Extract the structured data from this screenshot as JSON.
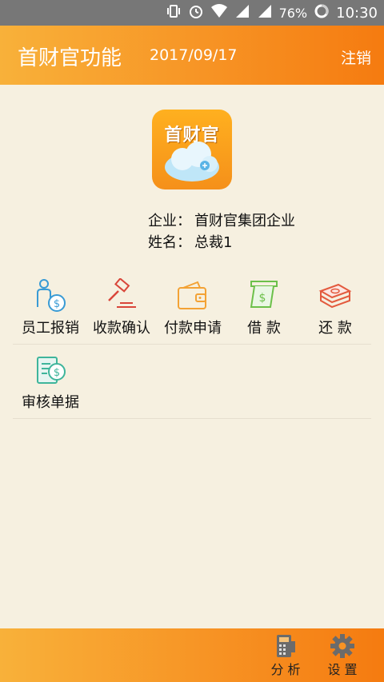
{
  "status_bar": {
    "battery": "76%",
    "time": "10:30"
  },
  "header": {
    "title": "首财官功能",
    "date": "2017/09/17",
    "logout": "注销"
  },
  "logo": {
    "text": "首财官"
  },
  "profile": {
    "company_label": "企业：",
    "company": "首财官集团企业",
    "name_label": "姓名：",
    "name": "总裁1"
  },
  "functions": [
    {
      "label": "员工报销",
      "icon": "employee-reimburse-icon"
    },
    {
      "label": "收款确认",
      "icon": "gavel-icon"
    },
    {
      "label": "付款申请",
      "icon": "wallet-icon"
    },
    {
      "label": "借 款",
      "icon": "cash-dispense-icon"
    },
    {
      "label": "还 款",
      "icon": "money-stack-icon"
    },
    {
      "label": "审核单据",
      "icon": "document-audit-icon"
    }
  ],
  "bottom_nav": {
    "analyze": "分 析",
    "settings": "设 置"
  },
  "colors": {
    "header_orange": "#f79324",
    "background": "#f6f0e0"
  }
}
